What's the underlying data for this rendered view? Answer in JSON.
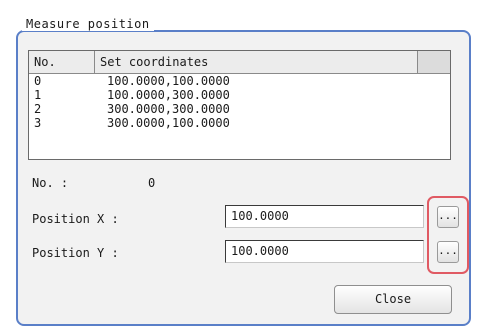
{
  "dialog": {
    "group_title": "Measure position",
    "table": {
      "columns": [
        "No.",
        "Set coordinates"
      ],
      "rows": [
        {
          "no": "0",
          "coords": "100.0000,100.0000"
        },
        {
          "no": "1",
          "coords": "100.0000,300.0000"
        },
        {
          "no": "2",
          "coords": "300.0000,300.0000"
        },
        {
          "no": "3",
          "coords": "300.0000,100.0000"
        }
      ]
    },
    "no_label": "No. :",
    "no_value": "0",
    "position_x_label": "Position X :",
    "position_x_value": "100.0000",
    "position_y_label": "Position Y :",
    "position_y_value": "100.0000",
    "ellipsis_label": "...",
    "close_label": "Close",
    "highlight_color": "#e05a63",
    "frame_color": "#5a7fc8"
  }
}
